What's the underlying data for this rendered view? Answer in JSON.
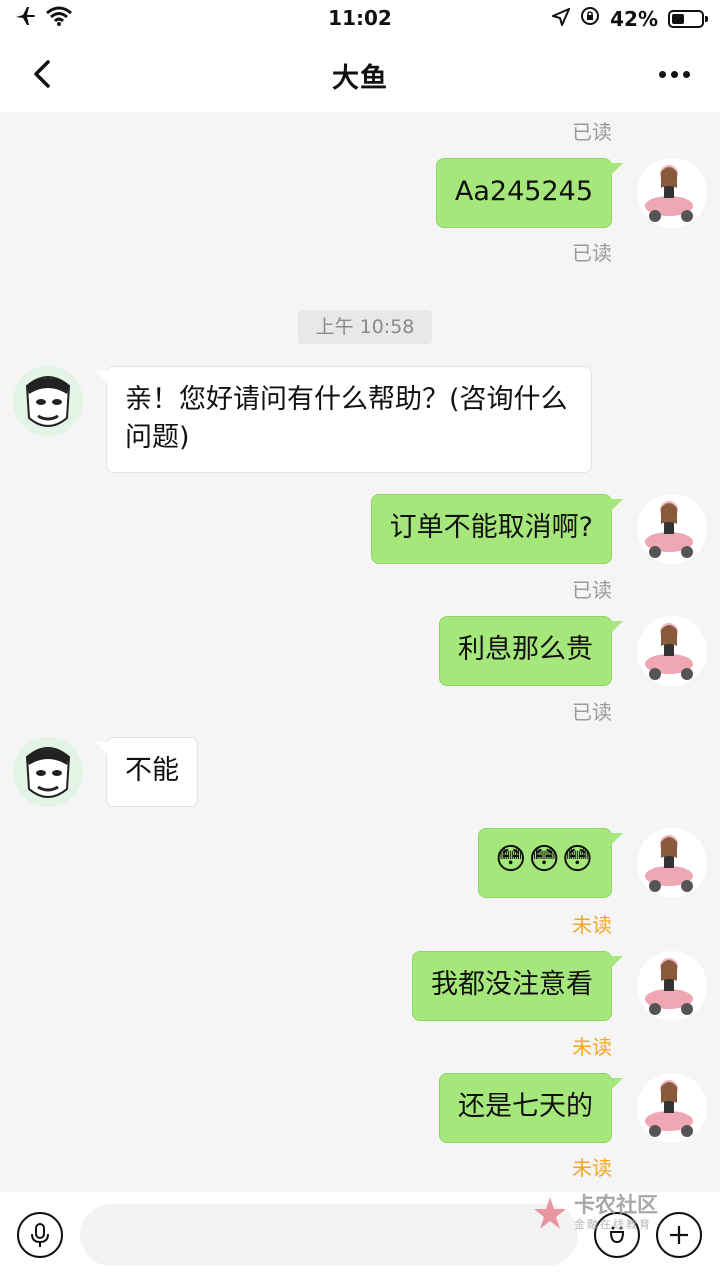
{
  "status_bar": {
    "time": "11:02",
    "battery_percent": "42%",
    "battery_level": 0.42
  },
  "header": {
    "title": "大鱼",
    "back_icon": "chevron-left-icon",
    "more_icon": "more-dots-icon"
  },
  "chat": {
    "timestamp": "上午 10:58",
    "messages": [
      {
        "from": "me",
        "text": "Aa245245",
        "status": "已读"
      },
      {
        "from": "other",
        "text": "亲！您好请问有什么帮助？(咨询什么问题)"
      },
      {
        "from": "me",
        "text": "订单不能取消啊?",
        "status": "已读"
      },
      {
        "from": "me",
        "text": "利息那么贵",
        "status": "已读"
      },
      {
        "from": "other",
        "text": "不能"
      },
      {
        "from": "me",
        "text": "😳😳😳",
        "status": "未读"
      },
      {
        "from": "me",
        "text": "我都没注意看",
        "status": "未读"
      },
      {
        "from": "me",
        "text": "还是七天的",
        "status": "未读"
      }
    ],
    "top_status": "已读"
  },
  "input_bar": {
    "voice_icon": "microphone-icon",
    "emoji_icon": "smile-icon",
    "plus_icon": "plus-icon",
    "placeholder": ""
  },
  "watermark": {
    "title": "卡农社区",
    "subtitle": "金融在线教育"
  },
  "colors": {
    "my_bubble": "#a6e77b",
    "unread": "#f5a623",
    "read": "#9a9a9a"
  }
}
